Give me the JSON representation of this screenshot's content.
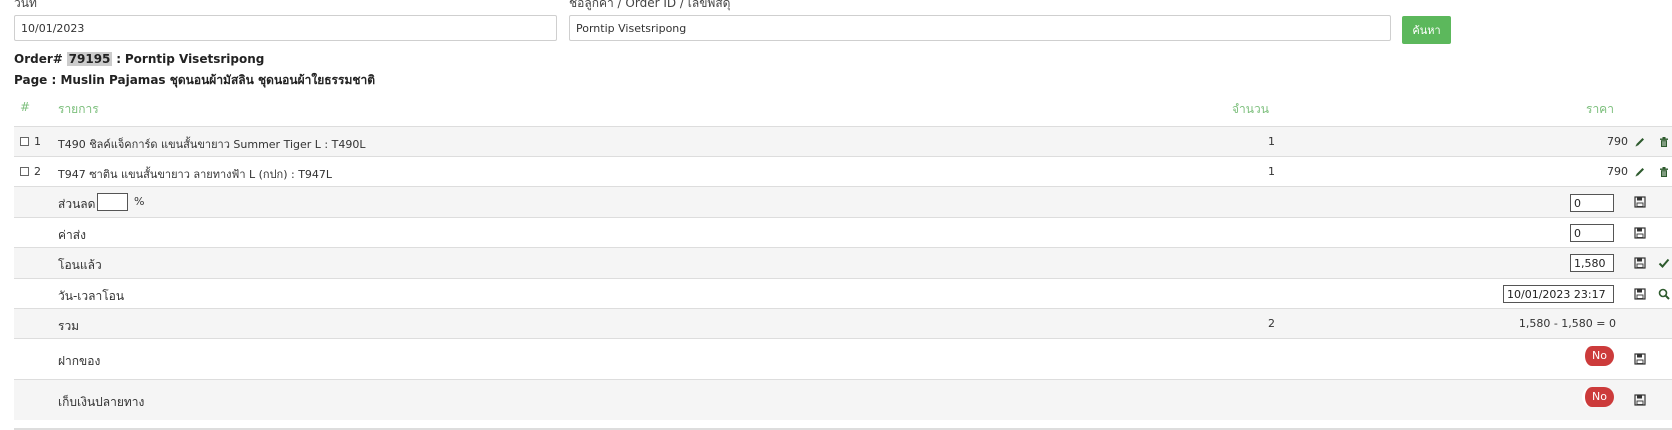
{
  "filters": {
    "date_label": "วันที่",
    "date_value": "10/01/2023",
    "customer_label": "ชื่อลูกค้า / Order ID / เลขพัสดุ",
    "customer_value": "Porntip Visetsripong",
    "search_button": "ค้นหา"
  },
  "order": {
    "prefix": "Order#",
    "id": "79195",
    "separator": ":",
    "customer": "Porntip Visetsripong",
    "page_line": "Page : Muslin Pajamas ชุดนอนผ้ามัสลิน ชุดนอนผ้าใยธรรมชาติ"
  },
  "table": {
    "headers": {
      "index": "#",
      "item": "รายการ",
      "qty": "จำนวน",
      "price": "ราคา"
    },
    "items": [
      {
        "no": "1",
        "name": "T490 ชิลค์แจ็คการ์ด แขนสั้นขายาว Summer Tiger L : T490L",
        "qty": "1",
        "price": "790"
      },
      {
        "no": "2",
        "name": "T947 ซาติน แขนสั้นขายาว ลายทางฟ้า L (กปก) : T947L",
        "qty": "1",
        "price": "790"
      }
    ],
    "discount": {
      "label": "ส่วนลด",
      "percent_value": "",
      "percent_sign": "%",
      "value": "0"
    },
    "shipping": {
      "label": "ค่าส่ง",
      "value": "0"
    },
    "transferred": {
      "label": "โอนแล้ว",
      "value": "1,580"
    },
    "transfer_time": {
      "label": "วัน-เวลาโอน",
      "value": "10/01/2023 23:17"
    },
    "total": {
      "label": "รวม",
      "qty": "2",
      "summary": "1,580 - 1,580 = 0"
    },
    "deposit": {
      "label": "ฝากของ",
      "toggle": "No"
    },
    "cod": {
      "label": "เก็บเงินปลายทาง",
      "toggle": "No"
    }
  },
  "icons": {
    "edit": "pencil-icon",
    "delete": "trash-icon",
    "save": "floppy-disk-icon",
    "confirm": "check-icon",
    "search": "magnifier-icon"
  },
  "colors": {
    "accent_green": "#5cb85c",
    "header_green": "#7cbf7c",
    "toggle_red": "#cc3b3b",
    "icon_dark_green": "#2d5a2d"
  }
}
